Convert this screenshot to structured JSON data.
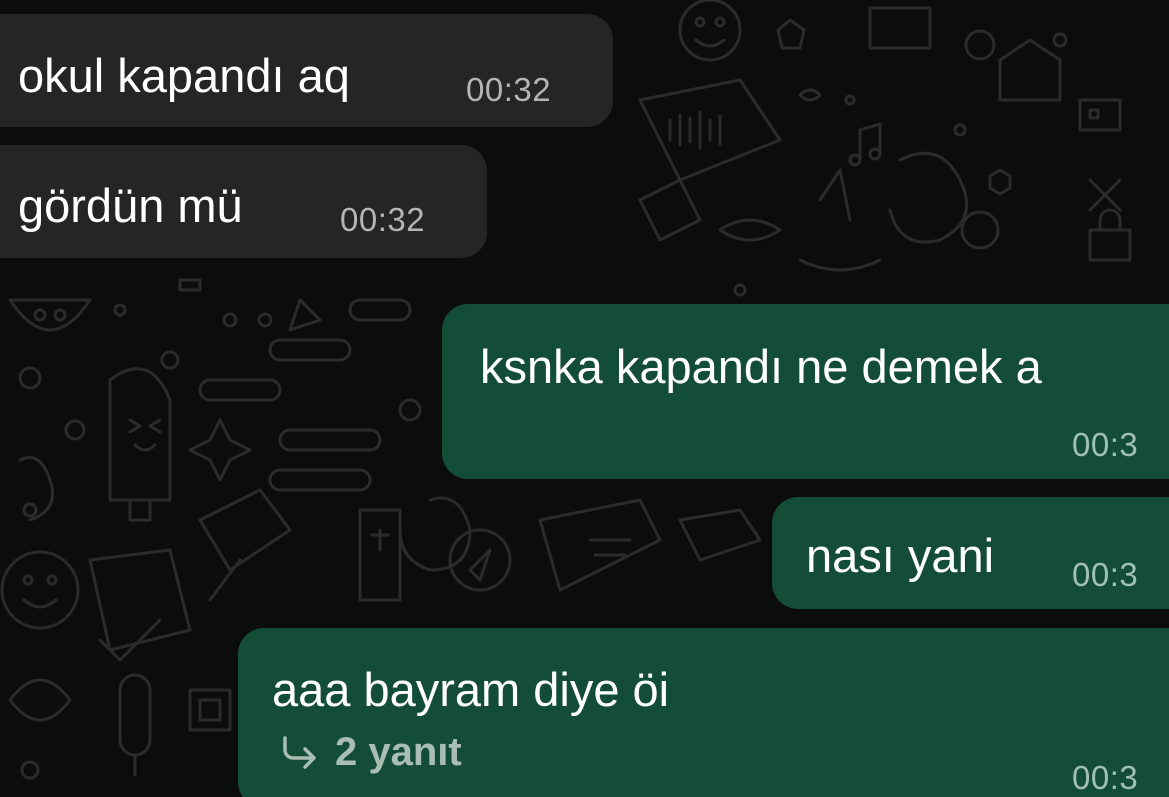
{
  "chat": {
    "theme": {
      "background": "#0b0c0c",
      "incoming_bubble": "#242626",
      "outgoing_bubble": "#144d37",
      "text_color": "#ffffff"
    },
    "messages": [
      {
        "direction": "incoming",
        "text": "okul kapandı aq",
        "time": "00:32"
      },
      {
        "direction": "incoming",
        "text": "gördün mü",
        "time": "00:32"
      },
      {
        "direction": "outgoing",
        "text": "ksnka kapandı ne demek a",
        "time": "00:3"
      },
      {
        "direction": "outgoing",
        "text": "nası yani",
        "time": "00:3"
      },
      {
        "direction": "outgoing",
        "text": "aaa bayram diye öi",
        "time": "00:3",
        "replies_icon": "reply-arrow-icon",
        "replies_label": "2 yanıt"
      }
    ]
  }
}
